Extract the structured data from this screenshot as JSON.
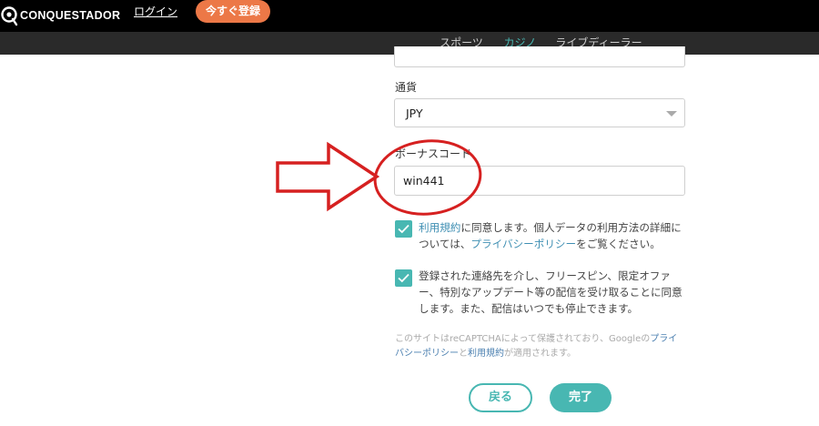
{
  "header": {
    "logo_text": "CONQUESTADOR",
    "login_label": "ログイン",
    "join_label": "今すぐ登録"
  },
  "subnav": {
    "tabs": [
      {
        "label": "スポーツ",
        "color": "#5b87b8"
      },
      {
        "label": "カジノ",
        "color": "#48b7b2",
        "active": true
      },
      {
        "label": "ライブディーラー",
        "color": "#e96f3f"
      }
    ]
  },
  "form": {
    "currency_label": "通貨",
    "currency_value": "JPY",
    "bonus_label": "ボーナスコード",
    "bonus_value": "win441",
    "terms": {
      "link": "利用規約",
      "text1": "に同意します。個人データの利用方法の詳細については、",
      "privacy_link": "プライバシーポリシー",
      "text2": "をご覧ください。",
      "checked": true
    },
    "marketing": {
      "text": "登録された連絡先を介し、フリースピン、限定オファー、特別なアップデート等の配信を受け取ることに同意します。また、配信はいつでも停止できます。",
      "checked": true
    },
    "recaptcha": {
      "text1": "このサイトはreCAPTCHAによって保護されており、Googleの",
      "privacy_link": "プライバシーポリシー",
      "text2": "と",
      "terms_link": "利用規約",
      "text3": "が適用されます。"
    },
    "back_label": "戻る",
    "done_label": "完了"
  },
  "colors": {
    "accent": "#48b7b2",
    "join_button": "#ec7847",
    "annotation": "#d62020"
  }
}
